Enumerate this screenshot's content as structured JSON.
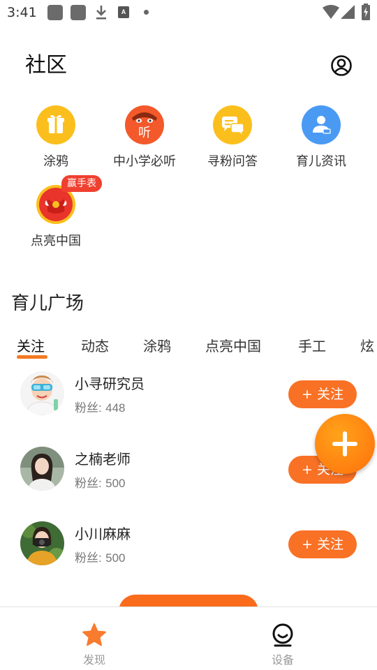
{
  "status_bar": {
    "time": "3:41"
  },
  "header": {
    "title": "社区"
  },
  "shortcuts": [
    {
      "label": "涂鸦",
      "icon": "gift-icon",
      "color": "#fbbf1d"
    },
    {
      "label": "中小学必听",
      "icon": "listen-mascot-icon",
      "color": "#f4592b"
    },
    {
      "label": "寻粉问答",
      "icon": "chat-bubble-icon",
      "color": "#fbbf1d"
    },
    {
      "label": "育儿资讯",
      "icon": "parenting-info-icon",
      "color": "#4a9af4"
    },
    {
      "label": "点亮中国",
      "icon": "red-envelope-icon",
      "color": "#e8342a",
      "badge": "赢手表"
    }
  ],
  "section": {
    "title": "育儿广场"
  },
  "tabs": [
    "关注",
    "动态",
    "涂鸦",
    "点亮中国",
    "手工",
    "炫"
  ],
  "active_tab": "关注",
  "users": [
    {
      "name": "小寻研究员",
      "fans_label": "粉丝:",
      "fans": "448",
      "follow_label": "+ 关注"
    },
    {
      "name": "之楠老师",
      "fans_label": "粉丝:",
      "fans": "500",
      "follow_label": "+ 关注"
    },
    {
      "name": "小川麻麻",
      "fans_label": "粉丝:",
      "fans": "500",
      "follow_label": "+ 关注"
    }
  ],
  "bottom_nav": [
    {
      "label": "发现",
      "icon": "star-icon",
      "active": true
    },
    {
      "label": "设备",
      "icon": "device-icon",
      "active": false
    }
  ],
  "colors": {
    "accent": "#f97125",
    "tab_underline": "#f57a21",
    "nav_active": "#f97b2e"
  }
}
